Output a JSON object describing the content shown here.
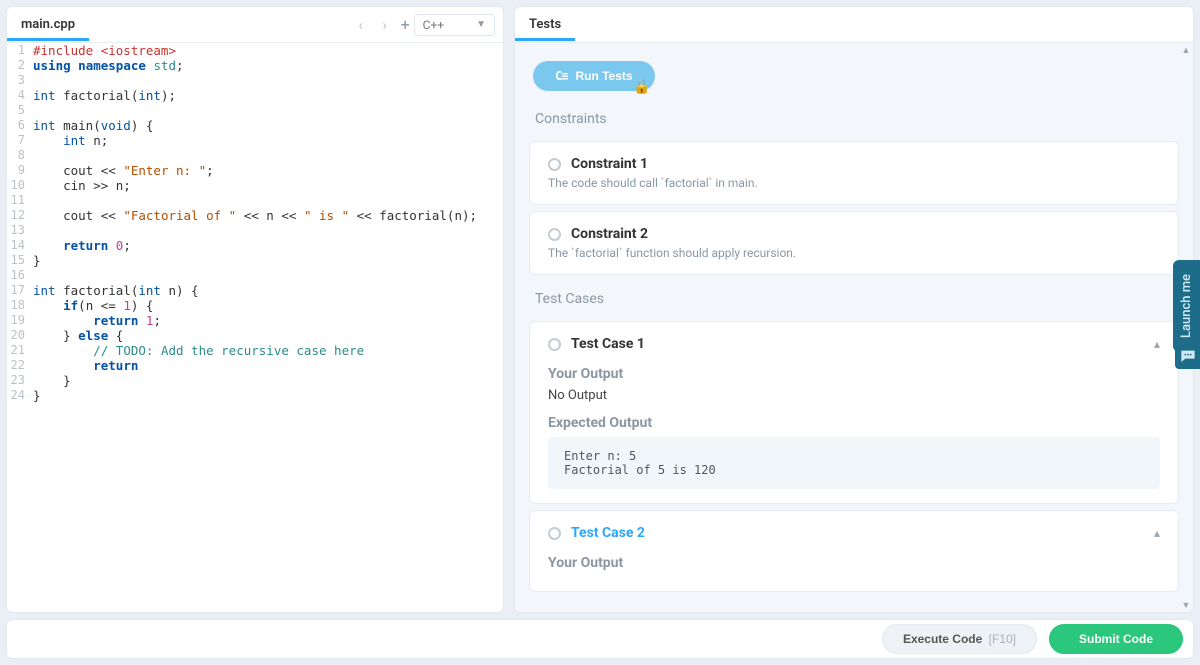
{
  "editor": {
    "filename": "main.cpp",
    "language": "C++",
    "lines": [
      [
        {
          "t": "preproc",
          "v": "#include <iostream>"
        }
      ],
      [
        {
          "t": "kw",
          "v": "using"
        },
        {
          "t": "text",
          "v": " "
        },
        {
          "t": "kw",
          "v": "namespace"
        },
        {
          "t": "text",
          "v": " "
        },
        {
          "t": "ns",
          "v": "std"
        },
        {
          "t": "text",
          "v": ";"
        }
      ],
      [],
      [
        {
          "t": "type",
          "v": "int"
        },
        {
          "t": "text",
          "v": " factorial("
        },
        {
          "t": "type",
          "v": "int"
        },
        {
          "t": "text",
          "v": ");"
        }
      ],
      [],
      [
        {
          "t": "type",
          "v": "int"
        },
        {
          "t": "text",
          "v": " main("
        },
        {
          "t": "type",
          "v": "void"
        },
        {
          "t": "text",
          "v": ") {"
        }
      ],
      [
        {
          "t": "text",
          "v": "    "
        },
        {
          "t": "type",
          "v": "int"
        },
        {
          "t": "text",
          "v": " n;"
        }
      ],
      [],
      [
        {
          "t": "text",
          "v": "    cout << "
        },
        {
          "t": "str",
          "v": "\"Enter n: \""
        },
        {
          "t": "text",
          "v": ";"
        }
      ],
      [
        {
          "t": "text",
          "v": "    cin >> n;"
        }
      ],
      [],
      [
        {
          "t": "text",
          "v": "    cout << "
        },
        {
          "t": "str",
          "v": "\"Factorial of \""
        },
        {
          "t": "text",
          "v": " << n << "
        },
        {
          "t": "str",
          "v": "\" is \""
        },
        {
          "t": "text",
          "v": " << factorial(n);"
        }
      ],
      [],
      [
        {
          "t": "text",
          "v": "    "
        },
        {
          "t": "kw",
          "v": "return"
        },
        {
          "t": "text",
          "v": " "
        },
        {
          "t": "num",
          "v": "0"
        },
        {
          "t": "text",
          "v": ";"
        }
      ],
      [
        {
          "t": "text",
          "v": "}"
        }
      ],
      [],
      [
        {
          "t": "type",
          "v": "int"
        },
        {
          "t": "text",
          "v": " factorial("
        },
        {
          "t": "type",
          "v": "int"
        },
        {
          "t": "text",
          "v": " n) {"
        }
      ],
      [
        {
          "t": "text",
          "v": "    "
        },
        {
          "t": "kw",
          "v": "if"
        },
        {
          "t": "text",
          "v": "(n <= "
        },
        {
          "t": "num",
          "v": "1"
        },
        {
          "t": "text",
          "v": ") {"
        }
      ],
      [
        {
          "t": "text",
          "v": "        "
        },
        {
          "t": "kw",
          "v": "return"
        },
        {
          "t": "text",
          "v": " "
        },
        {
          "t": "num",
          "v": "1"
        },
        {
          "t": "text",
          "v": ";"
        }
      ],
      [
        {
          "t": "text",
          "v": "    } "
        },
        {
          "t": "kw",
          "v": "else"
        },
        {
          "t": "text",
          "v": " {"
        }
      ],
      [
        {
          "t": "text",
          "v": "        "
        },
        {
          "t": "comment",
          "v": "// TODO: Add the recursive case here"
        }
      ],
      [
        {
          "t": "text",
          "v": "        "
        },
        {
          "t": "kw",
          "v": "return"
        }
      ],
      [
        {
          "t": "text",
          "v": "    }"
        }
      ],
      [
        {
          "t": "text",
          "v": "}"
        }
      ]
    ]
  },
  "tests": {
    "tab_label": "Tests",
    "run_button": "Run Tests",
    "constraints_header": "Constraints",
    "constraints": [
      {
        "title": "Constraint 1",
        "desc": "The code should call `factorial` in main."
      },
      {
        "title": "Constraint 2",
        "desc": "The `factorial` function should apply recursion."
      }
    ],
    "testcases_header": "Test Cases",
    "cases": [
      {
        "title": "Test Case 1",
        "your_output_label": "Your Output",
        "your_output": "No Output",
        "expected_label": "Expected Output",
        "expected": "Enter n: 5\nFactorial of 5 is 120",
        "highlight": false
      },
      {
        "title": "Test Case 2",
        "your_output_label": "Your Output",
        "highlight": true
      }
    ]
  },
  "footer": {
    "execute_label": "Execute Code",
    "execute_hint": "[F10]",
    "submit_label": "Submit Code"
  },
  "widgets": {
    "launch_me": "Launch me"
  }
}
